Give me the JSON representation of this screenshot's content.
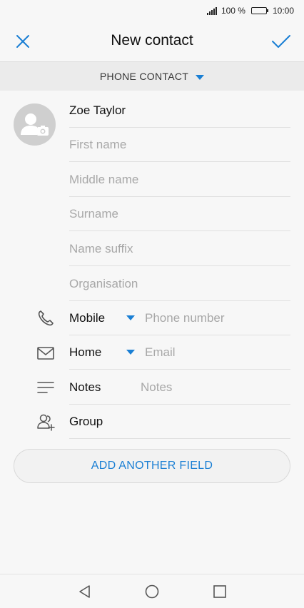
{
  "status": {
    "battery_percent": "100 %",
    "time": "10:00"
  },
  "header": {
    "title": "New contact"
  },
  "account": {
    "label": "PHONE CONTACT"
  },
  "fields": {
    "name": "Zoe Taylor",
    "first_name": "First name",
    "middle_name": "Middle name",
    "surname": "Surname",
    "name_suffix": "Name suffix",
    "organisation": "Organisation"
  },
  "phone": {
    "type": "Mobile",
    "placeholder": "Phone number"
  },
  "email": {
    "type": "Home",
    "placeholder": "Email"
  },
  "notes": {
    "label": "Notes",
    "placeholder": "Notes"
  },
  "group": {
    "label": "Group"
  },
  "add_field": "ADD ANOTHER FIELD",
  "colors": {
    "accent": "#1a7fd4",
    "background": "#f7f7f7"
  },
  "icons": [
    "close-icon",
    "check-icon",
    "caret-down-icon",
    "camera-avatar-icon",
    "phone-icon",
    "mail-icon",
    "notes-icon",
    "group-icon",
    "back-icon",
    "home-icon",
    "recents-icon"
  ]
}
